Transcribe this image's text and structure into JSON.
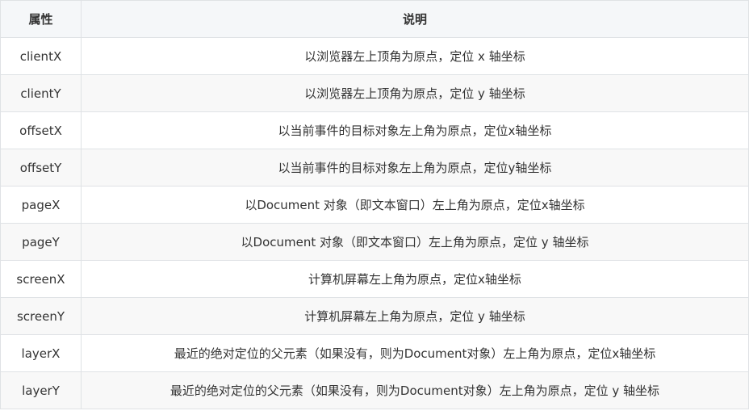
{
  "table": {
    "headers": [
      "属性",
      "说明"
    ],
    "rows": [
      {
        "attr": "clientX",
        "desc": "以浏览器左上顶角为原点，定位 x 轴坐标"
      },
      {
        "attr": "clientY",
        "desc": "以浏览器左上顶角为原点，定位 y 轴坐标"
      },
      {
        "attr": "offsetX",
        "desc": "以当前事件的目标对象左上角为原点，定位x轴坐标"
      },
      {
        "attr": "offsetY",
        "desc": "以当前事件的目标对象左上角为原点，定位y轴坐标"
      },
      {
        "attr": "pageX",
        "desc": "以Document 对象（即文本窗口）左上角为原点，定位x轴坐标"
      },
      {
        "attr": "pageY",
        "desc": "以Document 对象（即文本窗口）左上角为原点，定位 y 轴坐标"
      },
      {
        "attr": "screenX",
        "desc": "计算机屏幕左上角为原点，定位x轴坐标"
      },
      {
        "attr": "screenY",
        "desc": "计算机屏幕左上角为原点，定位 y 轴坐标"
      },
      {
        "attr": "layerX",
        "desc": "最近的绝对定位的父元素（如果没有，则为Document对象）左上角为原点，定位x轴坐标"
      },
      {
        "attr": "layerY",
        "desc": "最近的绝对定位的父元素（如果没有，则为Document对象）左上角为原点，定位 y 轴坐标"
      }
    ]
  }
}
